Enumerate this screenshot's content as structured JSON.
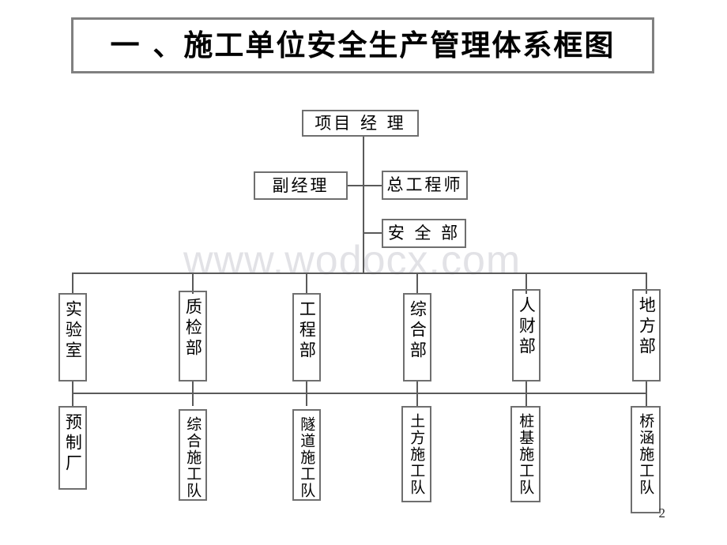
{
  "document": {
    "page_number": "2",
    "watermark": "www.wodocx.com"
  },
  "title": {
    "text": "一 、施工单位安全生产管理体系框图"
  },
  "chart_data": {
    "type": "diagram",
    "diagram_kind": "organization-chart",
    "title": "一 、施工单位安全生产管理体系框图",
    "levels": [
      {
        "level": 1,
        "nodes": [
          {
            "id": "project-manager",
            "label": "项目 经 理",
            "orientation": "horizontal"
          }
        ]
      },
      {
        "level": 2,
        "nodes": [
          {
            "id": "deputy-manager",
            "label": "副经理",
            "orientation": "horizontal"
          },
          {
            "id": "chief-engineer",
            "label": "总工程师",
            "orientation": "horizontal"
          }
        ]
      },
      {
        "level": 3,
        "nodes": [
          {
            "id": "safety-department",
            "label": "安 全 部",
            "orientation": "horizontal"
          }
        ]
      },
      {
        "level": 4,
        "nodes": [
          {
            "id": "laboratory",
            "label": "实验室",
            "orientation": "vertical"
          },
          {
            "id": "quality-inspection-department",
            "label": "质检部",
            "orientation": "vertical"
          },
          {
            "id": "engineering-department",
            "label": "工程部",
            "orientation": "vertical"
          },
          {
            "id": "general-affairs-department",
            "label": "综合部",
            "orientation": "vertical"
          },
          {
            "id": "hr-finance-department",
            "label": "人财部",
            "orientation": "vertical"
          },
          {
            "id": "local-affairs-department",
            "label": "地方部",
            "orientation": "vertical"
          }
        ]
      },
      {
        "level": 5,
        "nodes": [
          {
            "id": "precast-plant",
            "label": "预制厂",
            "orientation": "vertical"
          },
          {
            "id": "general-construction-team",
            "label": "综合施工队",
            "orientation": "vertical"
          },
          {
            "id": "tunnel-construction-team",
            "label": "隧道施工队",
            "orientation": "vertical"
          },
          {
            "id": "earthwork-construction-team",
            "label": "土方施工队",
            "orientation": "vertical"
          },
          {
            "id": "pile-foundation-construction-team",
            "label": "桩基施工队",
            "orientation": "vertical"
          },
          {
            "id": "bridge-culvert-construction-team",
            "label": "桥涵施工队",
            "orientation": "vertical"
          }
        ]
      }
    ],
    "edges": [
      {
        "from": "project-manager",
        "to": "deputy-manager"
      },
      {
        "from": "project-manager",
        "to": "chief-engineer"
      },
      {
        "from": "project-manager",
        "to": "safety-department"
      },
      {
        "from": "project-manager",
        "to": "laboratory"
      },
      {
        "from": "project-manager",
        "to": "quality-inspection-department"
      },
      {
        "from": "project-manager",
        "to": "engineering-department"
      },
      {
        "from": "project-manager",
        "to": "general-affairs-department"
      },
      {
        "from": "project-manager",
        "to": "hr-finance-department"
      },
      {
        "from": "project-manager",
        "to": "local-affairs-department"
      },
      {
        "from": "laboratory",
        "to": "precast-plant"
      },
      {
        "from": "quality-inspection-department",
        "to": "general-construction-team"
      },
      {
        "from": "engineering-department",
        "to": "tunnel-construction-team"
      },
      {
        "from": "general-affairs-department",
        "to": "earthwork-construction-team"
      },
      {
        "from": "hr-finance-department",
        "to": "pile-foundation-construction-team"
      },
      {
        "from": "local-affairs-department",
        "to": "bridge-culvert-construction-team"
      }
    ],
    "colors": {
      "box_border": "#6f6f6f",
      "title_border": "#808080",
      "line": "#5a5a5a",
      "text": "#000000",
      "watermark": "#e2e2e6",
      "background": "#ffffff"
    }
  }
}
